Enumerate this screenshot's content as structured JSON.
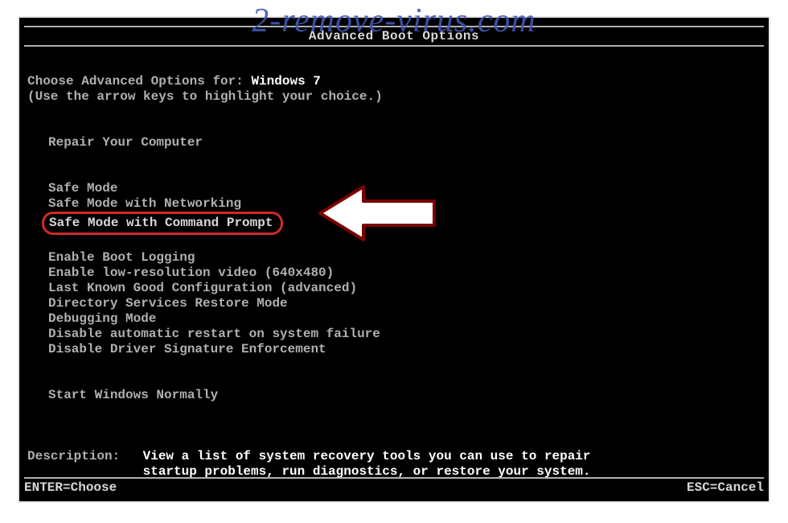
{
  "watermark": "2-remove-virus.com",
  "title": "Advanced Boot Options",
  "prompt_prefix": "Choose Advanced Options for: ",
  "os": "Windows 7",
  "hint": "(Use the arrow keys to highlight your choice.)",
  "groups": {
    "repair": [
      "Repair Your Computer"
    ],
    "safe": [
      "Safe Mode",
      "Safe Mode with Networking",
      "Safe Mode with Command Prompt"
    ],
    "misc": [
      "Enable Boot Logging",
      "Enable low-resolution video (640x480)",
      "Last Known Good Configuration (advanced)",
      "Directory Services Restore Mode",
      "Debugging Mode",
      "Disable automatic restart on system failure",
      "Disable Driver Signature Enforcement"
    ],
    "normal": [
      "Start Windows Normally"
    ]
  },
  "highlighted_index": 2,
  "description_label": "Description:",
  "description_line1": "View a list of system recovery tools you can use to repair",
  "description_line2": "startup problems, run diagnostics, or restore your system.",
  "footer_left": "ENTER=Choose",
  "footer_right": "ESC=Cancel"
}
